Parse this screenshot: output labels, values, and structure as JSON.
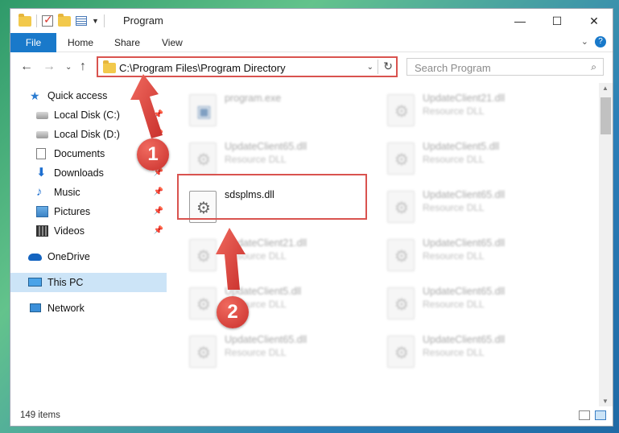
{
  "window": {
    "title": "Program",
    "controls": {
      "minimize": "—",
      "maximize": "☐",
      "close": "✕"
    }
  },
  "ribbon": {
    "tabs": [
      "File",
      "Home",
      "Share",
      "View"
    ],
    "expand": "⌄",
    "help": "?"
  },
  "nav": {
    "back": "←",
    "forward": "→",
    "recent": "⌄",
    "up": "↑",
    "address": "C:\\Program Files\\Program Directory",
    "address_dropdown": "⌄",
    "refresh": "↻",
    "search_placeholder": "Search Program",
    "search_icon": "⌕"
  },
  "sidebar": {
    "items": [
      {
        "label": "Quick access",
        "icon": "star-icon"
      },
      {
        "label": "Local Disk (C:)",
        "icon": "disk-icon"
      },
      {
        "label": "Local Disk (D:)",
        "icon": "disk-icon"
      },
      {
        "label": "Documents",
        "icon": "documents-icon"
      },
      {
        "label": "Downloads",
        "icon": "downloads-icon"
      },
      {
        "label": "Music",
        "icon": "music-icon"
      },
      {
        "label": "Pictures",
        "icon": "pictures-icon"
      },
      {
        "label": "Videos",
        "icon": "videos-icon"
      },
      {
        "label": "OneDrive",
        "icon": "onedrive-icon"
      },
      {
        "label": "This PC",
        "icon": "this-pc-icon"
      },
      {
        "label": "Network",
        "icon": "network-icon"
      }
    ],
    "pin": "📌"
  },
  "files": [
    {
      "name": "program.exe",
      "type": ""
    },
    {
      "name": "UpdateClient21.dll",
      "type": "Resource DLL"
    },
    {
      "name": "UpdateClient65.dll",
      "type": "Resource DLL"
    },
    {
      "name": "UpdateClient5.dll",
      "type": "Resource DLL"
    },
    {
      "name": "sdsplms.dll",
      "type": ""
    },
    {
      "name": "UpdateClient65.dll",
      "type": "Resource DLL"
    },
    {
      "name": "UpdateClient21.dll",
      "type": "Resource DLL"
    },
    {
      "name": "UpdateClient65.dll",
      "type": "Resource DLL"
    },
    {
      "name": "UpdateClient5.dll",
      "type": "Resource DLL"
    },
    {
      "name": "UpdateClient65.dll",
      "type": "Resource DLL"
    },
    {
      "name": "UpdateClient65.dll",
      "type": "Resource DLL"
    },
    {
      "name": "UpdateClient65.dll",
      "type": "Resource DLL"
    }
  ],
  "status": {
    "count": "149 items"
  },
  "annotations": {
    "badge1": "1",
    "badge2": "2",
    "color": "#d9534f"
  },
  "colors": {
    "accent": "#1979ca",
    "selection": "#cce4f7",
    "highlight": "#d9534f"
  }
}
